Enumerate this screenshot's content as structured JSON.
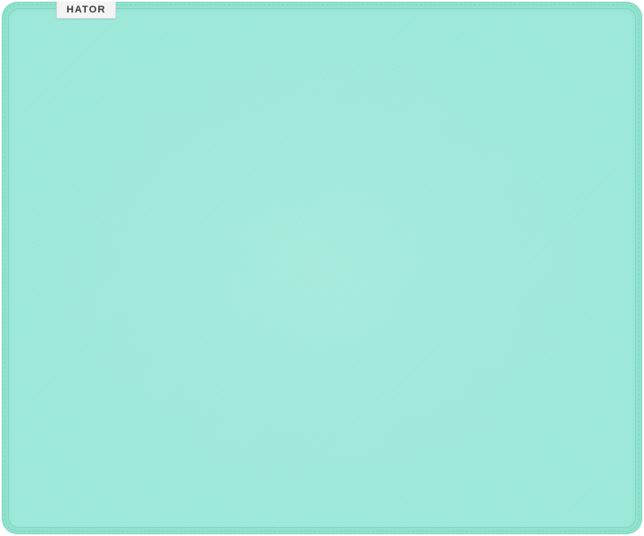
{
  "product": {
    "brand_label": "HATOR",
    "colors": {
      "border": "#8fe3cf",
      "surface": "#9eeadb",
      "tag_background": "#f4f4f4",
      "tag_text": "#3a3a3a"
    }
  }
}
